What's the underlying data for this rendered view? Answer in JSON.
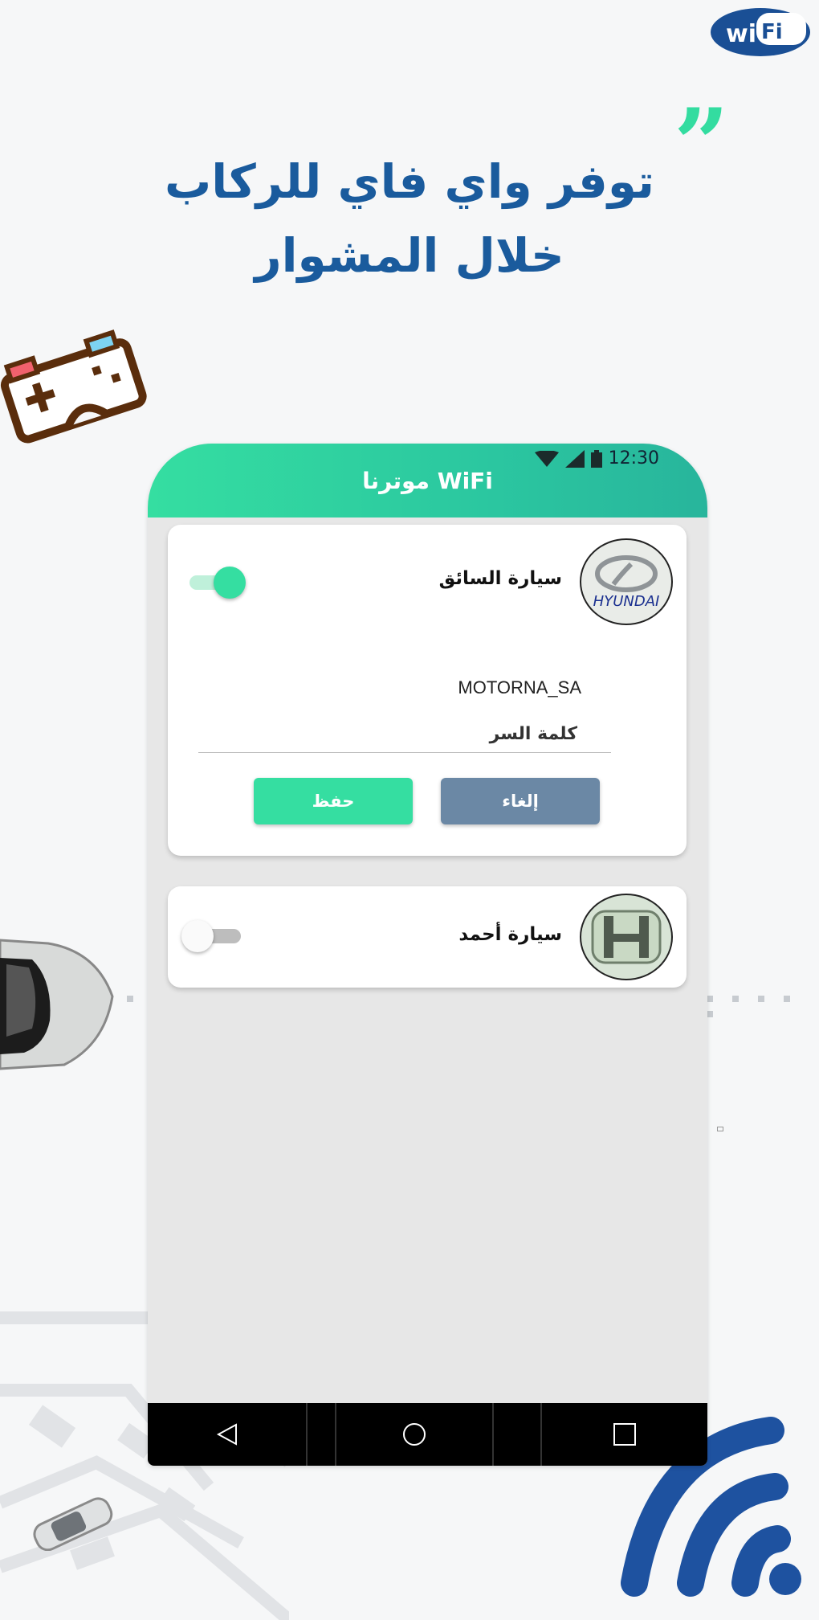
{
  "headline": {
    "line1": "توفر واي فاي للركاب",
    "line2": "خلال المشوار"
  },
  "status_bar": {
    "time": "12:30"
  },
  "app": {
    "title": "WiFi موترنا"
  },
  "cars": [
    {
      "name": "سيارة السائق",
      "brand_logo_text": "HYUNDAI",
      "toggle_on": true,
      "ssid": "MOTORNA_SA",
      "password_label": "كلمة السر",
      "cancel_label": "إلغاء",
      "save_label": "حفظ"
    },
    {
      "name": "سيارة أحمد",
      "toggle_on": false
    }
  ],
  "colors": {
    "accent": "#33dca0",
    "headline": "#1a5b9d",
    "cancel_button": "#6b88a5",
    "save_button": "#35dea1"
  },
  "icons": {
    "navbar": [
      "back-icon",
      "home-icon",
      "recents-icon"
    ],
    "status": [
      "wifi-signal-icon",
      "cell-signal-icon",
      "battery-icon"
    ]
  }
}
